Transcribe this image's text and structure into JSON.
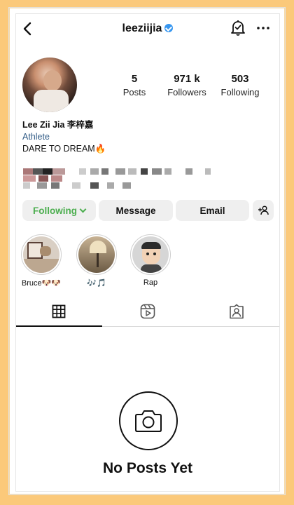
{
  "header": {
    "username": "leeziijia",
    "verified": true
  },
  "profile": {
    "stats": [
      {
        "value": "5",
        "label": "Posts"
      },
      {
        "value": "971 k",
        "label": "Followers"
      },
      {
        "value": "503",
        "label": "Following"
      }
    ],
    "name": "Lee Zii Jia 李梓嘉",
    "category": "Athlete",
    "bio": "DARE TO DREAM🔥"
  },
  "actions": {
    "following": "Following",
    "message": "Message",
    "email": "Email"
  },
  "highlights": [
    {
      "label": "Bruce🐶🐶"
    },
    {
      "label": "🎶🎵"
    },
    {
      "label": "Rap"
    }
  ],
  "tabs": [
    "posts-grid",
    "reels",
    "tagged"
  ],
  "empty_state": {
    "title": "No Posts Yet"
  },
  "colors": {
    "background": "#fbc97a",
    "following_green": "#4cae4f",
    "verified_blue": "#3897f0",
    "category_blue": "#2f5a85"
  }
}
